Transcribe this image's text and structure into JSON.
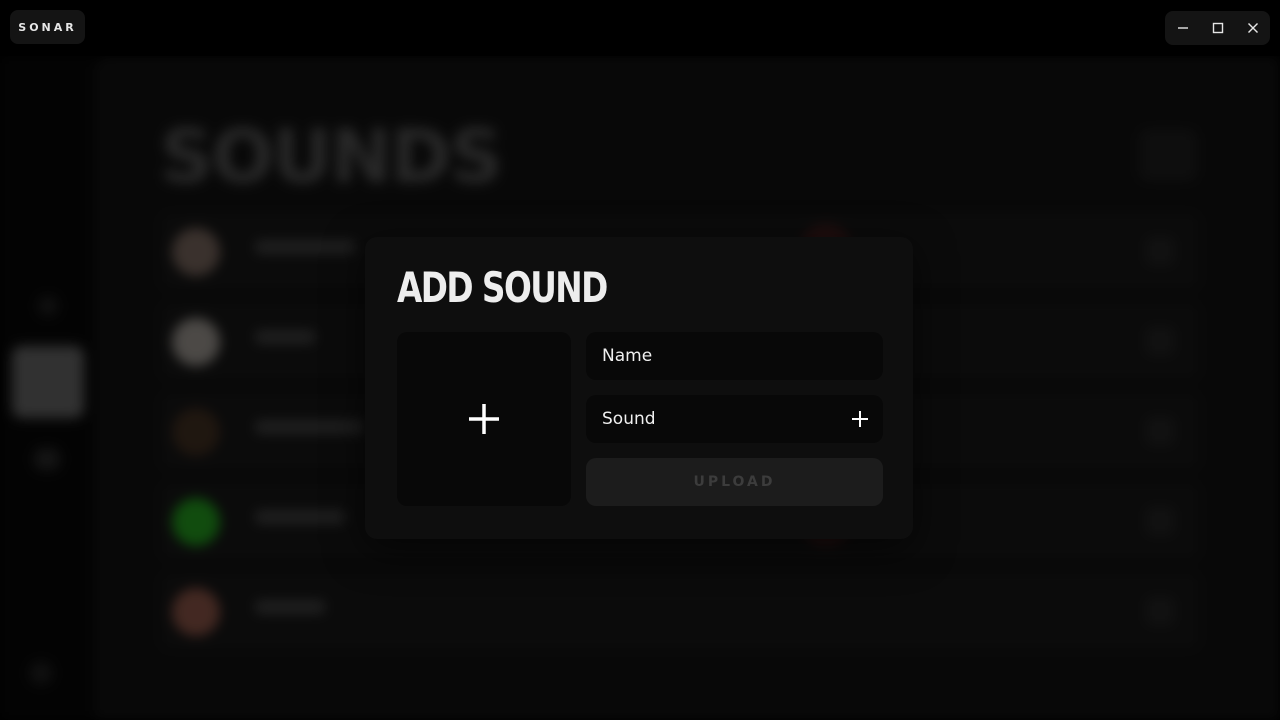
{
  "app": {
    "brand": "SONAR",
    "window_controls": [
      "minimize",
      "maximize",
      "close"
    ]
  },
  "background": {
    "heading": "SOUNDS"
  },
  "modal": {
    "title": "ADD SOUND",
    "name_placeholder": "Name",
    "sound_label": "Sound",
    "upload_label": "UPLOAD"
  },
  "icons": {
    "image_add": "plus-icon",
    "sound_add": "plus-icon",
    "minimize": "minimize-icon",
    "maximize": "maximize-icon",
    "close": "close-icon"
  },
  "colors": {
    "background": "#000000",
    "modal": "#0e0e0e",
    "field": "#080808",
    "upload_disabled": "#1c1c1c"
  }
}
